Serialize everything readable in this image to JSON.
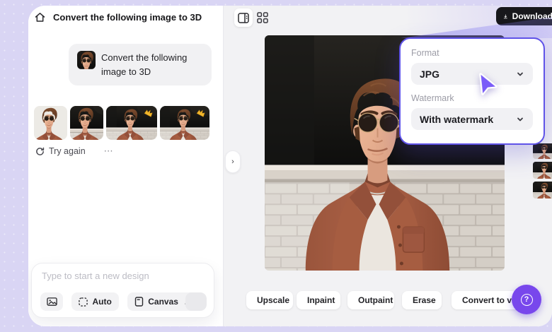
{
  "app": {
    "title": "Convert the following image to 3D"
  },
  "chat": {
    "message_text": "Convert the following image to 3D",
    "try_again": "Try again",
    "more": "⋯"
  },
  "composer": {
    "placeholder": "Type to start a new design",
    "auto": "Auto",
    "canvas": "Canvas",
    "canvas_arrow": "↗"
  },
  "canvas": {
    "download": "Download",
    "popup": {
      "format_label": "Format",
      "format_value": "JPG",
      "watermark_label": "Watermark",
      "watermark_value": "With watermark"
    },
    "toolbar": [
      {
        "label": "Upscale"
      },
      {
        "label": "Inpaint"
      },
      {
        "label": "Outpaint"
      },
      {
        "label": "Erase"
      },
      {
        "label": "Convert to video"
      }
    ],
    "help": "?"
  },
  "colors": {
    "background": "#D9D5F4",
    "accent_border": "#5F53E8",
    "cursor": "#7A5CF8",
    "help_button": "#7847EC",
    "download_button": "#17171B",
    "jacket": "#A65D41",
    "skin": "#E9B394",
    "hair": "#6B4128",
    "crown_badge": "#F2B72E"
  },
  "icons": {
    "home": "home-icon",
    "panel_view": "panel-view-icon",
    "grid_view": "grid-view-icon",
    "download": "download-icon",
    "refresh": "refresh-icon",
    "chevron_down": "chevron-down-icon",
    "chevron_right": "›",
    "image": "image-icon",
    "auto_select": "dashed-box-icon",
    "canvas_board": "canvas-icon",
    "upscale": "upscale-icon",
    "inpaint": "pen-icon",
    "outpaint": "selection-icon",
    "erase": "eraser-icon",
    "video": "video-icon",
    "crown": "crown-icon",
    "question": "question-icon"
  }
}
